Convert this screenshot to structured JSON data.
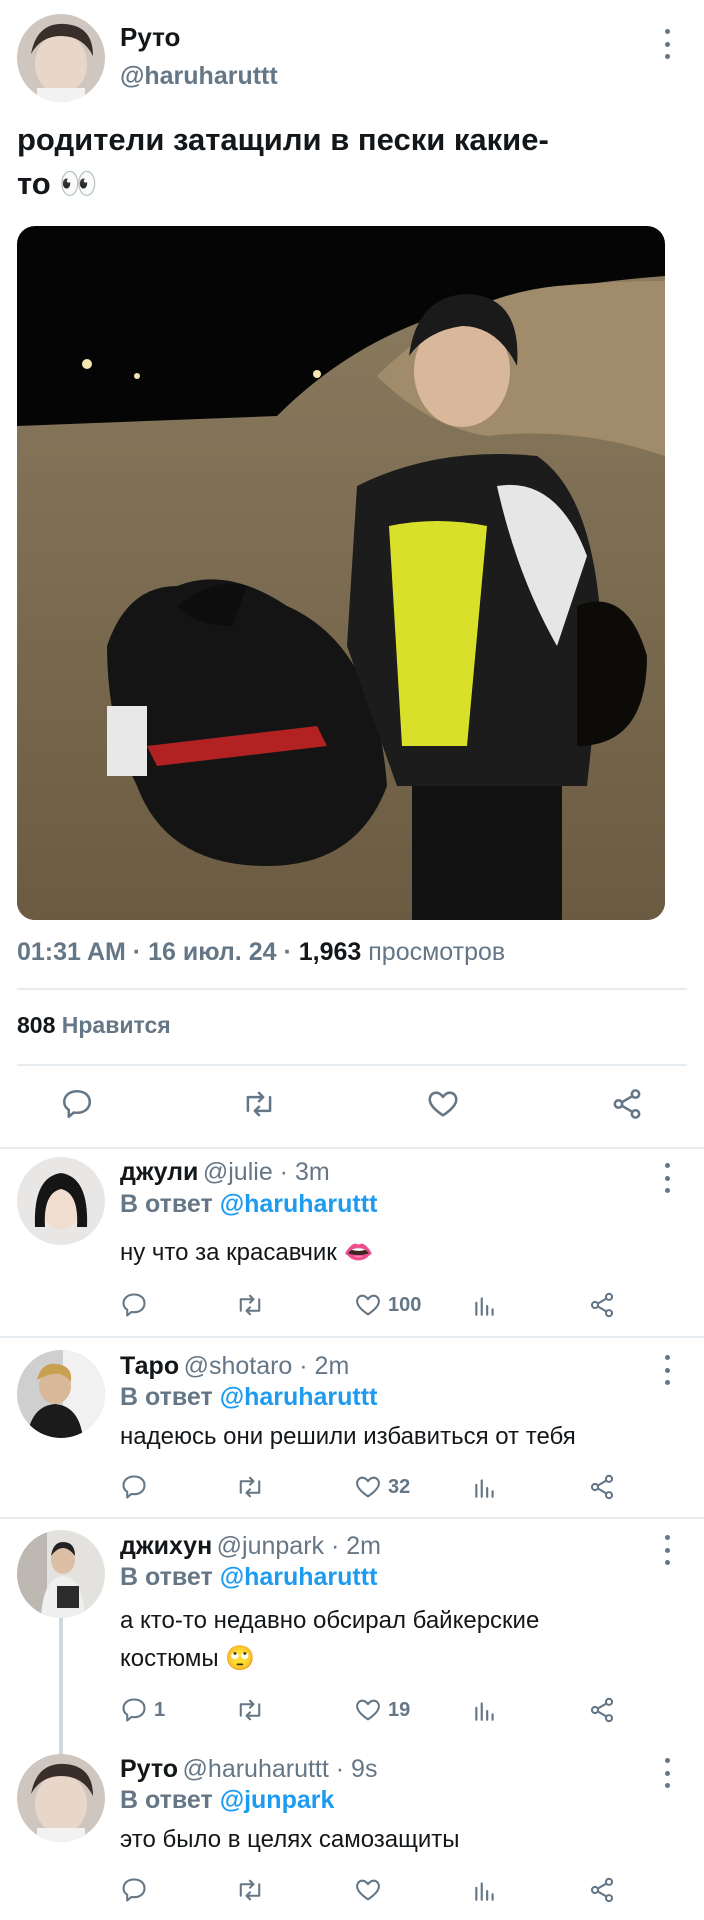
{
  "main_tweet": {
    "display_name": "Руто",
    "handle": "@haruharuttt",
    "text_line1": "родители затащили в пески какие-",
    "text_line2": "то 👀",
    "time": "01:31 AM",
    "date": "16 июл. 24",
    "views_count": "1,963",
    "views_label": "просмотров",
    "likes_count": "808",
    "likes_label": "Нравится"
  },
  "replies": [
    {
      "display_name": "джули",
      "meta": "@julie · 3m",
      "reply_prefix": "В ответ",
      "reply_to": "@haruharuttt",
      "text_line1": "ну что за красавчик 👄",
      "text_line2": "",
      "reply_count": "",
      "like_count": "100"
    },
    {
      "display_name": "Таро",
      "meta": "@shotaro · 2m",
      "reply_prefix": "В ответ",
      "reply_to": "@haruharuttt",
      "text_line1": "надеюсь они решили избавиться от тебя",
      "text_line2": "",
      "reply_count": "",
      "like_count": "32"
    },
    {
      "display_name": "джихун",
      "meta": "@junpark · 2m",
      "reply_prefix": "В ответ",
      "reply_to": "@haruharuttt",
      "text_line1": "а кто-то недавно обсирал байкерские",
      "text_line2": "костюмы 🙄",
      "reply_count": "1",
      "like_count": "19"
    },
    {
      "display_name": "Руто",
      "meta": "@haruharuttt · 9s",
      "reply_prefix": "В ответ",
      "reply_to": "@junpark",
      "text_line1": "это было в целях самозащиты",
      "text_line2": "",
      "reply_count": "",
      "like_count": ""
    }
  ],
  "icons": {
    "reply": "reply-icon",
    "retweet": "retweet-icon",
    "like": "heart-icon",
    "share": "share-icon",
    "stats": "stats-icon",
    "more": "more-icon"
  },
  "colors": {
    "link": "#1d9bf0",
    "muted": "#657786",
    "divider": "#e6ecf0"
  }
}
